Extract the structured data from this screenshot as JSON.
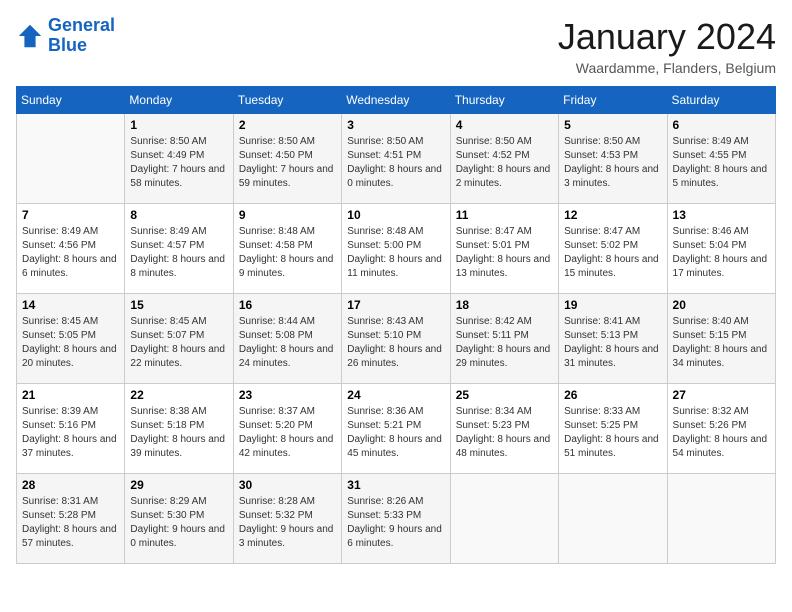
{
  "logo": {
    "line1": "General",
    "line2": "Blue"
  },
  "title": "January 2024",
  "location": "Waardamme, Flanders, Belgium",
  "days_of_week": [
    "Sunday",
    "Monday",
    "Tuesday",
    "Wednesday",
    "Thursday",
    "Friday",
    "Saturday"
  ],
  "weeks": [
    [
      {
        "day": "",
        "sunrise": "",
        "sunset": "",
        "daylight": ""
      },
      {
        "day": "1",
        "sunrise": "Sunrise: 8:50 AM",
        "sunset": "Sunset: 4:49 PM",
        "daylight": "Daylight: 7 hours and 58 minutes."
      },
      {
        "day": "2",
        "sunrise": "Sunrise: 8:50 AM",
        "sunset": "Sunset: 4:50 PM",
        "daylight": "Daylight: 7 hours and 59 minutes."
      },
      {
        "day": "3",
        "sunrise": "Sunrise: 8:50 AM",
        "sunset": "Sunset: 4:51 PM",
        "daylight": "Daylight: 8 hours and 0 minutes."
      },
      {
        "day": "4",
        "sunrise": "Sunrise: 8:50 AM",
        "sunset": "Sunset: 4:52 PM",
        "daylight": "Daylight: 8 hours and 2 minutes."
      },
      {
        "day": "5",
        "sunrise": "Sunrise: 8:50 AM",
        "sunset": "Sunset: 4:53 PM",
        "daylight": "Daylight: 8 hours and 3 minutes."
      },
      {
        "day": "6",
        "sunrise": "Sunrise: 8:49 AM",
        "sunset": "Sunset: 4:55 PM",
        "daylight": "Daylight: 8 hours and 5 minutes."
      }
    ],
    [
      {
        "day": "7",
        "sunrise": "Sunrise: 8:49 AM",
        "sunset": "Sunset: 4:56 PM",
        "daylight": "Daylight: 8 hours and 6 minutes."
      },
      {
        "day": "8",
        "sunrise": "Sunrise: 8:49 AM",
        "sunset": "Sunset: 4:57 PM",
        "daylight": "Daylight: 8 hours and 8 minutes."
      },
      {
        "day": "9",
        "sunrise": "Sunrise: 8:48 AM",
        "sunset": "Sunset: 4:58 PM",
        "daylight": "Daylight: 8 hours and 9 minutes."
      },
      {
        "day": "10",
        "sunrise": "Sunrise: 8:48 AM",
        "sunset": "Sunset: 5:00 PM",
        "daylight": "Daylight: 8 hours and 11 minutes."
      },
      {
        "day": "11",
        "sunrise": "Sunrise: 8:47 AM",
        "sunset": "Sunset: 5:01 PM",
        "daylight": "Daylight: 8 hours and 13 minutes."
      },
      {
        "day": "12",
        "sunrise": "Sunrise: 8:47 AM",
        "sunset": "Sunset: 5:02 PM",
        "daylight": "Daylight: 8 hours and 15 minutes."
      },
      {
        "day": "13",
        "sunrise": "Sunrise: 8:46 AM",
        "sunset": "Sunset: 5:04 PM",
        "daylight": "Daylight: 8 hours and 17 minutes."
      }
    ],
    [
      {
        "day": "14",
        "sunrise": "Sunrise: 8:45 AM",
        "sunset": "Sunset: 5:05 PM",
        "daylight": "Daylight: 8 hours and 20 minutes."
      },
      {
        "day": "15",
        "sunrise": "Sunrise: 8:45 AM",
        "sunset": "Sunset: 5:07 PM",
        "daylight": "Daylight: 8 hours and 22 minutes."
      },
      {
        "day": "16",
        "sunrise": "Sunrise: 8:44 AM",
        "sunset": "Sunset: 5:08 PM",
        "daylight": "Daylight: 8 hours and 24 minutes."
      },
      {
        "day": "17",
        "sunrise": "Sunrise: 8:43 AM",
        "sunset": "Sunset: 5:10 PM",
        "daylight": "Daylight: 8 hours and 26 minutes."
      },
      {
        "day": "18",
        "sunrise": "Sunrise: 8:42 AM",
        "sunset": "Sunset: 5:11 PM",
        "daylight": "Daylight: 8 hours and 29 minutes."
      },
      {
        "day": "19",
        "sunrise": "Sunrise: 8:41 AM",
        "sunset": "Sunset: 5:13 PM",
        "daylight": "Daylight: 8 hours and 31 minutes."
      },
      {
        "day": "20",
        "sunrise": "Sunrise: 8:40 AM",
        "sunset": "Sunset: 5:15 PM",
        "daylight": "Daylight: 8 hours and 34 minutes."
      }
    ],
    [
      {
        "day": "21",
        "sunrise": "Sunrise: 8:39 AM",
        "sunset": "Sunset: 5:16 PM",
        "daylight": "Daylight: 8 hours and 37 minutes."
      },
      {
        "day": "22",
        "sunrise": "Sunrise: 8:38 AM",
        "sunset": "Sunset: 5:18 PM",
        "daylight": "Daylight: 8 hours and 39 minutes."
      },
      {
        "day": "23",
        "sunrise": "Sunrise: 8:37 AM",
        "sunset": "Sunset: 5:20 PM",
        "daylight": "Daylight: 8 hours and 42 minutes."
      },
      {
        "day": "24",
        "sunrise": "Sunrise: 8:36 AM",
        "sunset": "Sunset: 5:21 PM",
        "daylight": "Daylight: 8 hours and 45 minutes."
      },
      {
        "day": "25",
        "sunrise": "Sunrise: 8:34 AM",
        "sunset": "Sunset: 5:23 PM",
        "daylight": "Daylight: 8 hours and 48 minutes."
      },
      {
        "day": "26",
        "sunrise": "Sunrise: 8:33 AM",
        "sunset": "Sunset: 5:25 PM",
        "daylight": "Daylight: 8 hours and 51 minutes."
      },
      {
        "day": "27",
        "sunrise": "Sunrise: 8:32 AM",
        "sunset": "Sunset: 5:26 PM",
        "daylight": "Daylight: 8 hours and 54 minutes."
      }
    ],
    [
      {
        "day": "28",
        "sunrise": "Sunrise: 8:31 AM",
        "sunset": "Sunset: 5:28 PM",
        "daylight": "Daylight: 8 hours and 57 minutes."
      },
      {
        "day": "29",
        "sunrise": "Sunrise: 8:29 AM",
        "sunset": "Sunset: 5:30 PM",
        "daylight": "Daylight: 9 hours and 0 minutes."
      },
      {
        "day": "30",
        "sunrise": "Sunrise: 8:28 AM",
        "sunset": "Sunset: 5:32 PM",
        "daylight": "Daylight: 9 hours and 3 minutes."
      },
      {
        "day": "31",
        "sunrise": "Sunrise: 8:26 AM",
        "sunset": "Sunset: 5:33 PM",
        "daylight": "Daylight: 9 hours and 6 minutes."
      },
      {
        "day": "",
        "sunrise": "",
        "sunset": "",
        "daylight": ""
      },
      {
        "day": "",
        "sunrise": "",
        "sunset": "",
        "daylight": ""
      },
      {
        "day": "",
        "sunrise": "",
        "sunset": "",
        "daylight": ""
      }
    ]
  ]
}
